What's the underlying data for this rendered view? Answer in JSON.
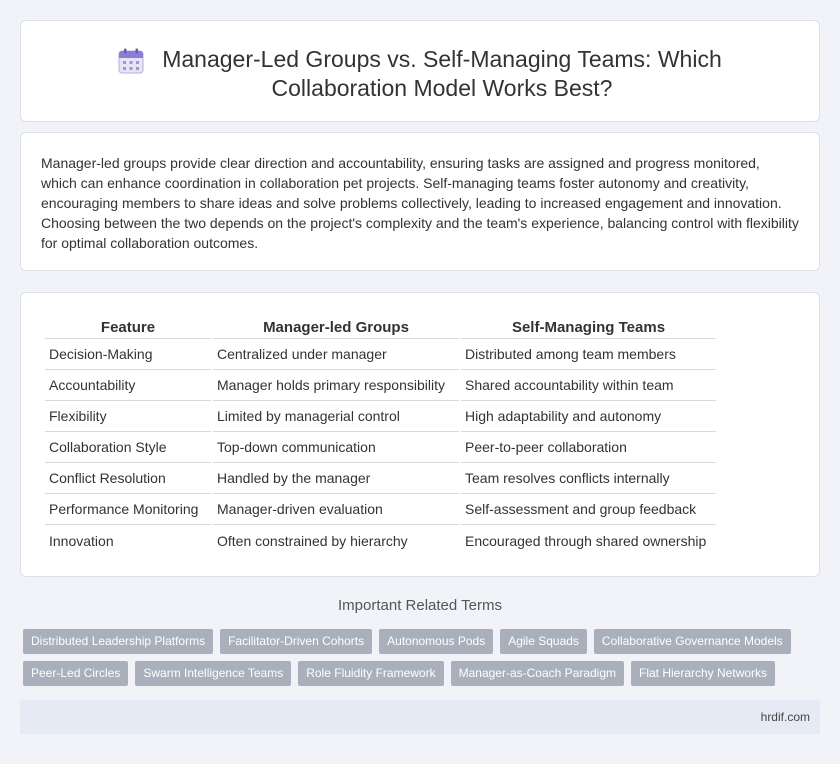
{
  "header": {
    "icon": "calendar-icon",
    "title_line1": "Manager-Led Groups vs. Self-Managing Teams: Which",
    "title_line2": "Collaboration Model Works Best?"
  },
  "intro": {
    "text": "Manager-led groups provide clear direction and accountability, ensuring tasks are assigned and progress monitored, which can enhance coordination in collaboration pet projects. Self-managing teams foster autonomy and creativity, encouraging members to share ideas and solve problems collectively, leading to increased engagement and innovation. Choosing between the two depends on the project's complexity and the team's experience, balancing control with flexibility for optimal collaboration outcomes."
  },
  "table": {
    "headers": [
      "Feature",
      "Manager-led Groups",
      "Self-Managing Teams"
    ],
    "rows": [
      [
        "Decision-Making",
        "Centralized under manager",
        "Distributed among team members"
      ],
      [
        "Accountability",
        "Manager holds primary responsibility",
        "Shared accountability within team"
      ],
      [
        "Flexibility",
        "Limited by managerial control",
        "High adaptability and autonomy"
      ],
      [
        "Collaboration Style",
        "Top-down communication",
        "Peer-to-peer collaboration"
      ],
      [
        "Conflict Resolution",
        "Handled by the manager",
        "Team resolves conflicts internally"
      ],
      [
        "Performance Monitoring",
        "Manager-driven evaluation",
        "Self-assessment and group feedback"
      ],
      [
        "Innovation",
        "Often constrained by hierarchy",
        "Encouraged through shared ownership"
      ]
    ]
  },
  "related": {
    "title": "Important Related Terms",
    "row1": [
      "Distributed Leadership Platforms",
      "Facilitator-Driven Cohorts",
      "Autonomous Pods",
      "Agile Squads",
      "Collaborative Governance Models"
    ],
    "row2": [
      "Peer-Led Circles",
      "Swarm Intelligence Teams",
      "Role Fluidity Framework",
      "Manager-as-Coach Paradigm",
      "Flat Hierarchy Networks"
    ]
  },
  "footer": {
    "site": "hrdif.com"
  },
  "colors": {
    "background": "#f1f3f8",
    "tag": "#a9b0bb",
    "footer": "#e6eaf4"
  }
}
